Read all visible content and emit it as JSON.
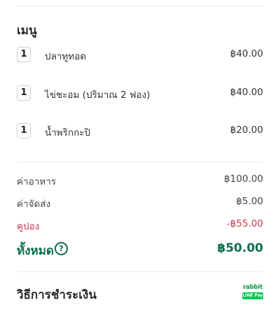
{
  "menu": {
    "title": "เมนู",
    "items": [
      {
        "qty": "1",
        "name": "ปลาทูทอด",
        "price": "฿40.00"
      },
      {
        "qty": "1",
        "name": "ไข่ชะอม (ปริมาณ 2 ฟอง)",
        "price": "฿40.00"
      },
      {
        "qty": "1",
        "name": "น้ำพริกกะปิ",
        "price": "฿20.00"
      }
    ]
  },
  "summary": {
    "food_label": "ค่าอาหาร",
    "food_value": "฿100.00",
    "delivery_label": "ค่าจัดส่ง",
    "delivery_value": "฿5.00",
    "coupon_label": "คูปอง",
    "coupon_value": "-฿55.00",
    "total_label": "ทั้งหมด",
    "total_value": "฿50.00",
    "help_icon": "question-circle-icon"
  },
  "payment": {
    "title": "วิธีการชำระเงิน",
    "logo_brand": "rabbit",
    "logo_badge": "LINE Pay"
  },
  "colors": {
    "accent_green": "#0d6e4f",
    "coupon_red": "#c8364e",
    "line_green": "#06c755"
  }
}
